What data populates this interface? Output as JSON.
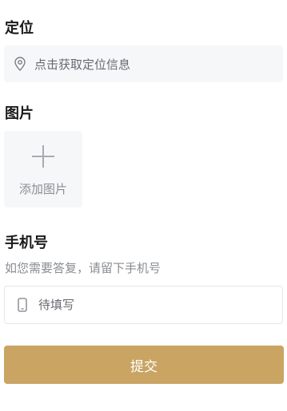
{
  "location": {
    "title": "定位",
    "placeholder": "点击获取定位信息",
    "icon": "location-pin-icon"
  },
  "image": {
    "title": "图片",
    "add_label": "添加图片",
    "icon": "plus-icon"
  },
  "phone": {
    "title": "手机号",
    "hint": "如您需要答复，请留下手机号",
    "placeholder": "待填写",
    "value": "",
    "icon": "mobile-phone-icon"
  },
  "submit": {
    "label": "提交"
  },
  "colors": {
    "accent": "#c9a463",
    "field_background": "#f6f7f9",
    "muted_text": "#8a8d92"
  }
}
